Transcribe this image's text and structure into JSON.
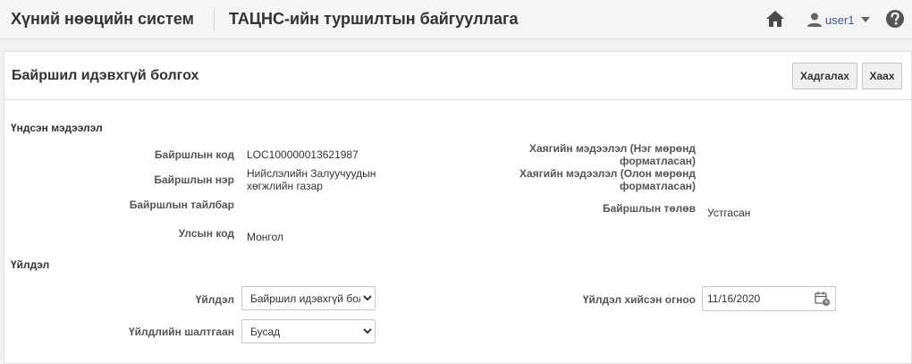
{
  "header": {
    "app_title": "Хүний нөөцийн систем",
    "org_title": "ТАЦНС-ийн туршилтын байгууллага",
    "user_name": "user1",
    "icons": {
      "home": "home-icon",
      "user": "user-icon",
      "caret": "caret-down-icon",
      "help": "help-icon"
    }
  },
  "page": {
    "title": "Байршил идэвхгүй болгох",
    "save_label": "Хадгалах",
    "close_label": "Хаах"
  },
  "basic_info": {
    "section_title": "Үндсэн мэдээлэл",
    "location_code_label": "Байршлын код",
    "location_code_value": "LOC100000013621987",
    "location_name_label": "Байршлын нэр",
    "location_name_value_line1": "Нийслэлийн Залуучуудын",
    "location_name_value_line2": "хөгжлийн газар",
    "location_desc_label": "Байршлын тайлбар",
    "location_desc_value": "",
    "country_code_label": "Улсын код",
    "country_code_value": "Монгол",
    "address_single_label_line1": "Хаягийн мэдээлэл (Нэг мөрөнд",
    "address_single_label_line2": "форматласан)",
    "address_multi_label_line1": "Хаягийн мэдээлэл (Олон мөрөнд",
    "address_multi_label_line2": "форматласан)",
    "status_label": "Байршлын төлөв",
    "status_value": "Устгасан"
  },
  "action": {
    "section_title": "Үйлдэл",
    "action_label": "Үйлдэл",
    "action_selected": "Байршил идэвхгүй болгох",
    "reason_label": "Үйлдлийн шалтгаан",
    "reason_selected": "Бусад",
    "date_label": "Үйлдэл хийсэн огноо",
    "date_value": "11/16/2020",
    "calendar_icon": "calendar-icon"
  },
  "colors": {
    "header_bg": "#f5f5f5",
    "page_bg": "#f1f1f1",
    "user_link": "#3a5a8c",
    "text": "#333333"
  }
}
